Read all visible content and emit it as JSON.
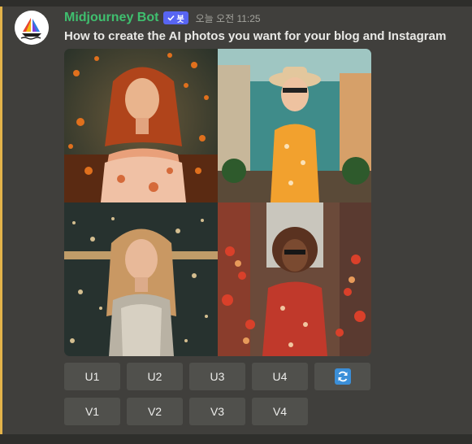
{
  "message": {
    "username": "Midjourney Bot",
    "bot_tag": "봇",
    "timestamp": "오늘 오전 11:25",
    "content": "How to create the AI photos you want for your blog and Instagram"
  },
  "image_grid": {
    "images": [
      {
        "icon": "portrait-autumn-leaves"
      },
      {
        "icon": "portrait-sunhat-street"
      },
      {
        "icon": "portrait-bokeh-lights"
      },
      {
        "icon": "portrait-flowers-street"
      }
    ]
  },
  "buttons": {
    "upscale": [
      "U1",
      "U2",
      "U3",
      "U4"
    ],
    "variation": [
      "V1",
      "V2",
      "V3",
      "V4"
    ],
    "reroll_icon": "refresh-icon"
  },
  "colors": {
    "username": "#3fbf6f",
    "bot_tag": "#5865f2",
    "highlight": "#e3b34a",
    "button": "#50504c",
    "refresh": "#3b8fd8"
  }
}
